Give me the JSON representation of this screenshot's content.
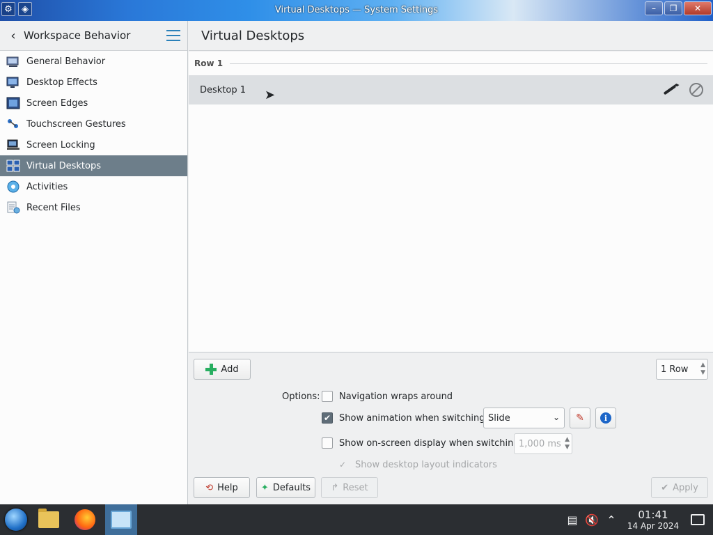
{
  "window": {
    "title": "Virtual Desktops — System Settings"
  },
  "sidebar": {
    "title": "Workspace Behavior",
    "items": [
      {
        "label": "General Behavior",
        "icon": "general-behavior-icon"
      },
      {
        "label": "Desktop Effects",
        "icon": "desktop-effects-icon"
      },
      {
        "label": "Screen Edges",
        "icon": "screen-edges-icon"
      },
      {
        "label": "Touchscreen Gestures",
        "icon": "touchscreen-gestures-icon"
      },
      {
        "label": "Screen Locking",
        "icon": "screen-locking-icon"
      },
      {
        "label": "Virtual Desktops",
        "icon": "virtual-desktops-icon",
        "active": true
      },
      {
        "label": "Activities",
        "icon": "activities-icon"
      },
      {
        "label": "Recent Files",
        "icon": "recent-files-icon"
      }
    ]
  },
  "main": {
    "title": "Virtual Desktops",
    "row_label": "Row 1",
    "desktops": [
      {
        "name": "Desktop 1"
      }
    ],
    "add_label": "Add",
    "rows_value": "1 Row",
    "options_label": "Options:",
    "options": {
      "nav_wraps": {
        "label": "Navigation wraps around",
        "checked": false
      },
      "show_animation": {
        "label": "Show animation when switching:",
        "checked": true
      },
      "animation_value": "Slide",
      "show_osd": {
        "label": "Show on-screen display when switching:",
        "checked": false
      },
      "osd_duration": "1,000 ms",
      "layout_indicators": {
        "label": "Show desktop layout indicators",
        "checked": true,
        "enabled": false
      }
    },
    "buttons": {
      "help": "Help",
      "defaults": "Defaults",
      "reset": "Reset",
      "apply": "Apply"
    }
  },
  "taskbar": {
    "time": "01:41",
    "date": "14 Apr 2024"
  },
  "colors": {
    "accent": "#2980b9",
    "selected_item": "#6d7e8a",
    "taskbar": "#2b2e32"
  }
}
